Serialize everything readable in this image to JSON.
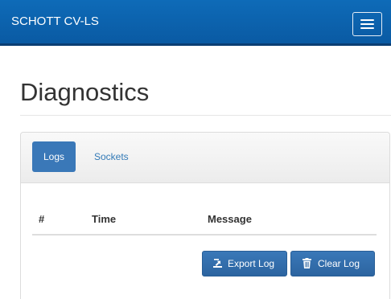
{
  "navbar": {
    "brand": "SCHOTT CV-LS",
    "menu_icon": "hamburger-icon"
  },
  "page": {
    "title": "Diagnostics"
  },
  "tabs": [
    {
      "label": "Logs",
      "active": true
    },
    {
      "label": "Sockets",
      "active": false
    }
  ],
  "table": {
    "columns": [
      "#",
      "Time",
      "Message"
    ],
    "rows": []
  },
  "actions": {
    "export_label": "Export Log",
    "export_icon": "export-icon",
    "clear_label": "Clear Log",
    "clear_icon": "trash-icon"
  },
  "colors": {
    "navbar": "#0a5aa3",
    "primary_button": "#3a78b8",
    "link": "#337ab7"
  }
}
